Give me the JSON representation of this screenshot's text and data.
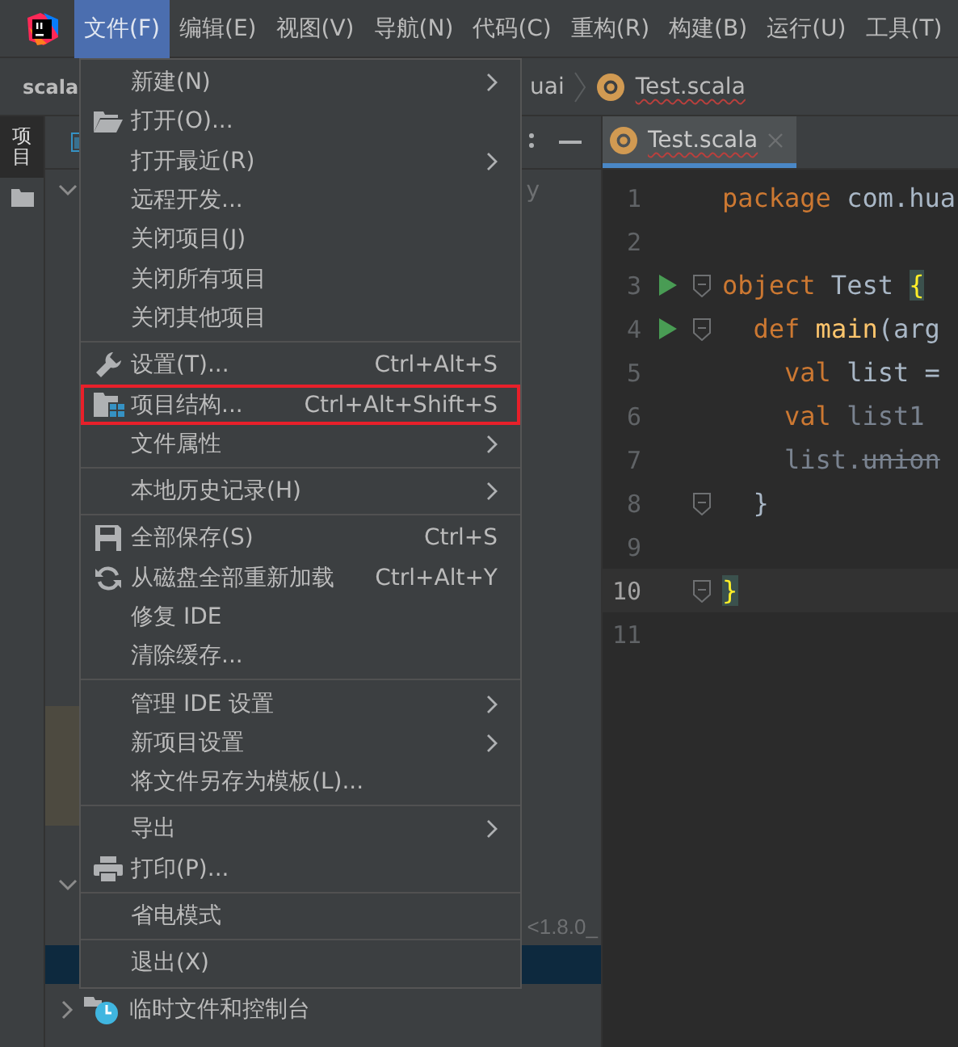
{
  "menubar": [
    {
      "label": "文件(F)",
      "selected": true
    },
    {
      "label": "编辑(E)",
      "selected": false
    },
    {
      "label": "视图(V)",
      "selected": false
    },
    {
      "label": "导航(N)",
      "selected": false
    },
    {
      "label": "代码(C)",
      "selected": false
    },
    {
      "label": "重构(R)",
      "selected": false
    },
    {
      "label": "构建(B)",
      "selected": false
    },
    {
      "label": "运行(U)",
      "selected": false
    },
    {
      "label": "工具(T)",
      "selected": false
    }
  ],
  "breadcrumb": {
    "project": "scala",
    "package": "uai",
    "file": "Test.scala"
  },
  "sidebar": {
    "tool": "项目"
  },
  "project_panel": {
    "row_1_tail": "y",
    "sdk_tail": "<1.8.0_",
    "bottom_item": "临时文件和控制台"
  },
  "editor": {
    "tab": "Test.scala",
    "lines": [
      {
        "number": "1",
        "run": false,
        "fold": false,
        "current": false,
        "tokens": [
          {
            "kind": "keyword",
            "text": "package"
          },
          {
            "kind": "plain",
            "text": " com.hua"
          }
        ]
      },
      {
        "number": "2",
        "run": false,
        "fold": false,
        "current": false
      },
      {
        "number": "3",
        "run": true,
        "fold": true,
        "current": false,
        "tokens": [
          {
            "kind": "keyword",
            "text": "object"
          },
          {
            "kind": "plain",
            "text": " Test "
          },
          {
            "kind": "brace",
            "text": "{"
          }
        ]
      },
      {
        "number": "4",
        "run": true,
        "fold": true,
        "current": false,
        "tokens": [
          {
            "kind": "keyword",
            "text": "  def"
          },
          {
            "kind": "function",
            "text": " main"
          },
          {
            "kind": "plain",
            "text": "(arg"
          }
        ]
      },
      {
        "number": "5",
        "run": false,
        "fold": false,
        "current": false,
        "tokens": [
          {
            "kind": "keyword",
            "text": "    val"
          },
          {
            "kind": "plain",
            "text": " list ="
          }
        ]
      },
      {
        "number": "6",
        "run": false,
        "fold": false,
        "current": false,
        "tokens": [
          {
            "kind": "keyword",
            "text": "    val"
          },
          {
            "kind": "dim",
            "text": " list1"
          }
        ]
      },
      {
        "number": "7",
        "run": false,
        "fold": false,
        "current": false,
        "tokens": [
          {
            "kind": "dim",
            "text": "    list."
          },
          {
            "kind": "deprecated",
            "text": "union"
          }
        ]
      },
      {
        "number": "8",
        "run": false,
        "fold": true,
        "current": false,
        "tokens": [
          {
            "kind": "plain",
            "text": "  }"
          }
        ]
      },
      {
        "number": "9",
        "run": false,
        "fold": false,
        "current": false
      },
      {
        "number": "10",
        "run": false,
        "fold": true,
        "current": true,
        "tokens": [
          {
            "kind": "brace",
            "text": "}"
          }
        ]
      },
      {
        "number": "11",
        "run": false,
        "fold": false,
        "current": false
      }
    ]
  },
  "file_menu": [
    {
      "kind": "item",
      "label": "新建(N)",
      "submenu": true,
      "outlined": false
    },
    {
      "kind": "open",
      "label": "打开(O)...",
      "submenu": false,
      "outlined": false
    },
    {
      "kind": "item",
      "label": "打开最近(R)",
      "submenu": true,
      "outlined": false
    },
    {
      "kind": "item",
      "label": "远程开发...",
      "submenu": false,
      "outlined": false
    },
    {
      "kind": "item",
      "label": "关闭项目(J)",
      "submenu": false,
      "outlined": false
    },
    {
      "kind": "item",
      "label": "关闭所有项目",
      "submenu": false,
      "outlined": false
    },
    {
      "kind": "item",
      "label": "关闭其他项目",
      "submenu": false,
      "outlined": false
    },
    {
      "kind": "separator"
    },
    {
      "kind": "settings",
      "label": "设置(T)...",
      "shortcut": "Ctrl+Alt+S",
      "submenu": false,
      "outlined": false
    },
    {
      "kind": "structure",
      "label": "项目结构...",
      "shortcut": "Ctrl+Alt+Shift+S",
      "submenu": false,
      "outlined": true
    },
    {
      "kind": "item",
      "label": "文件属性",
      "submenu": true,
      "outlined": false
    },
    {
      "kind": "separator"
    },
    {
      "kind": "item",
      "label": "本地历史记录(H)",
      "submenu": true,
      "outlined": false
    },
    {
      "kind": "separator"
    },
    {
      "kind": "save",
      "label": "全部保存(S)",
      "shortcut": "Ctrl+S",
      "submenu": false,
      "outlined": false
    },
    {
      "kind": "reload",
      "label": "从磁盘全部重新加载",
      "shortcut": "Ctrl+Alt+Y",
      "submenu": false,
      "outlined": false
    },
    {
      "kind": "item",
      "label": "修复 IDE",
      "submenu": false,
      "outlined": false
    },
    {
      "kind": "item",
      "label": "清除缓存...",
      "submenu": false,
      "outlined": false
    },
    {
      "kind": "separator"
    },
    {
      "kind": "item",
      "label": "管理 IDE 设置",
      "submenu": true,
      "outlined": false
    },
    {
      "kind": "item",
      "label": "新项目设置",
      "submenu": true,
      "outlined": false
    },
    {
      "kind": "item",
      "label": "将文件另存为模板(L)...",
      "submenu": false,
      "outlined": false
    },
    {
      "kind": "separator"
    },
    {
      "kind": "item",
      "label": "导出",
      "submenu": true,
      "outlined": false
    },
    {
      "kind": "print",
      "label": "打印(P)...",
      "submenu": false,
      "outlined": false
    },
    {
      "kind": "separator"
    },
    {
      "kind": "item",
      "label": "省电模式",
      "submenu": false,
      "outlined": false
    },
    {
      "kind": "separator"
    },
    {
      "kind": "item",
      "label": "退出(X)",
      "submenu": false,
      "outlined": false
    }
  ]
}
